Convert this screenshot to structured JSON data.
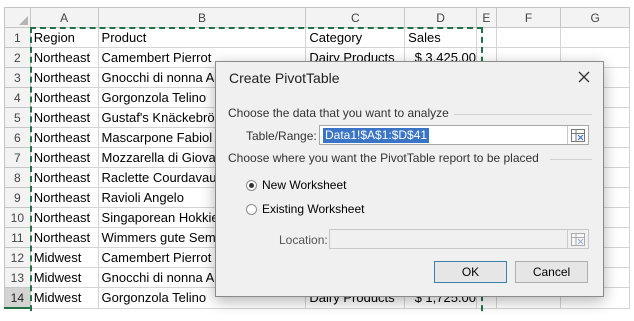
{
  "sheet": {
    "columns": [
      "A",
      "B",
      "C",
      "D",
      "E",
      "F",
      "G"
    ],
    "row_numbers": [
      "1",
      "2",
      "3",
      "4",
      "5",
      "6",
      "7",
      "8",
      "9",
      "10",
      "11",
      "12",
      "13",
      "14"
    ],
    "rows": [
      [
        "Region",
        "Product",
        "Category",
        "Sales"
      ],
      [
        "Northeast",
        "Camembert Pierrot",
        "Dairy Products",
        "$ 3,425.00"
      ],
      [
        "Northeast",
        "Gnocchi di nonna A",
        "",
        ""
      ],
      [
        "Northeast",
        "Gorgonzola Telino",
        "",
        ""
      ],
      [
        "Northeast",
        "Gustaf's Knäckebrö",
        "",
        ""
      ],
      [
        "Northeast",
        "Mascarpone Fabiol",
        "",
        ""
      ],
      [
        "Northeast",
        "Mozzarella di Giova",
        "",
        ""
      ],
      [
        "Northeast",
        "Raclette Courdavau",
        "",
        ""
      ],
      [
        "Northeast",
        "Ravioli Angelo",
        "",
        ""
      ],
      [
        "Northeast",
        "Singaporean Hokkie",
        "",
        ""
      ],
      [
        "Northeast",
        "Wimmers gute Sem",
        "",
        ""
      ],
      [
        "Midwest",
        "Camembert Pierrot",
        "",
        ""
      ],
      [
        "Midwest",
        "Gnocchi di nonna A",
        "",
        ""
      ],
      [
        "Midwest",
        "Gorgonzola Telino",
        "Dairy Products",
        "$ 1,725.00"
      ]
    ],
    "selected_row": "14",
    "accent_color": "#217346"
  },
  "dialog": {
    "title": "Create PivotTable",
    "close_icon": "close-icon",
    "section1_label": "Choose the data that you want to analyze",
    "table_range_label": "Table/Range:",
    "table_range_value": "Data1!$A$1:$D$41",
    "section2_label": "Choose where you want the PivotTable report to be placed",
    "radio_new": "New Worksheet",
    "radio_existing": "Existing Worksheet",
    "selected_option": "New Worksheet",
    "location_label": "Location:",
    "location_value": "",
    "ok_label": "OK",
    "cancel_label": "Cancel",
    "range_picker_icon": "range-picker-icon"
  }
}
